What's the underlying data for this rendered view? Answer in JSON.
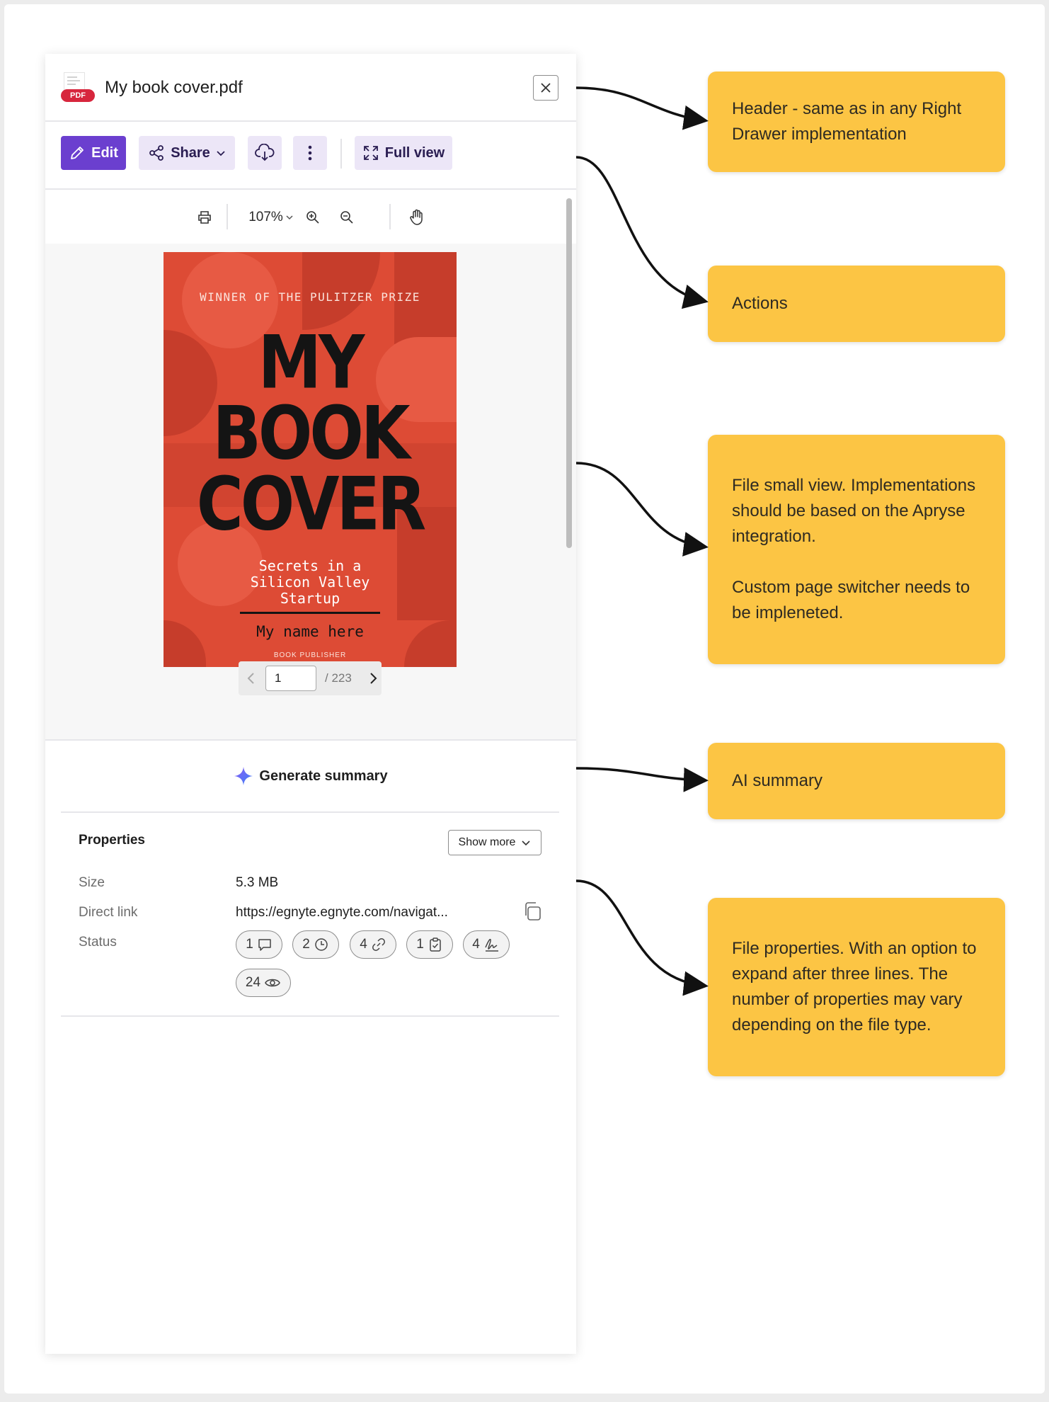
{
  "header": {
    "file_name": "My book cover.pdf",
    "file_badge": "PDF"
  },
  "toolbar": {
    "edit_label": "Edit",
    "share_label": "Share",
    "full_view_label": "Full view"
  },
  "viewer": {
    "zoom": "107%",
    "page_current": "1",
    "page_total": "/ 223",
    "cover": {
      "award": "WINNER OF THE PULITZER PRIZE",
      "title_line1": "MY",
      "title_line2": "BOOK",
      "title_line3": "COVER",
      "subtitle_line1": "Secrets in a",
      "subtitle_line2": "Silicon Valley",
      "subtitle_line3": "Startup",
      "author": "My name here",
      "publisher": "BOOK PUBLISHER"
    }
  },
  "ai": {
    "label": "Generate summary"
  },
  "properties": {
    "title": "Properties",
    "show_more": "Show more",
    "size_label": "Size",
    "size_value": "5.3 MB",
    "link_label": "Direct link",
    "link_value": "https://egnyte.egnyte.com/navigat...",
    "status_label": "Status",
    "status": [
      {
        "count": "1",
        "icon": "comment-icon"
      },
      {
        "count": "2",
        "icon": "clock-icon"
      },
      {
        "count": "4",
        "icon": "link-icon"
      },
      {
        "count": "1",
        "icon": "clipboard-check-icon"
      },
      {
        "count": "4",
        "icon": "signature-icon"
      },
      {
        "count": "24",
        "icon": "eye-icon"
      }
    ]
  },
  "notes": {
    "header": "Header - same as in any Right Drawer implementation",
    "actions": "Actions",
    "file_view_p1": "File small view. Implementations should be based on the Apryse integration.",
    "file_view_p2": "Custom page switcher needs to be impleneted.",
    "ai_summary": "AI summary",
    "file_properties": "File properties. With an option to expand after three lines. The number of properties may vary depending on the file type."
  },
  "colors": {
    "accent": "#6b3fcf",
    "accent_soft": "#ece6f7",
    "note_bg": "#fcc544",
    "cover_bg": "#dd4b35",
    "pdf_badge": "#d7263d"
  }
}
